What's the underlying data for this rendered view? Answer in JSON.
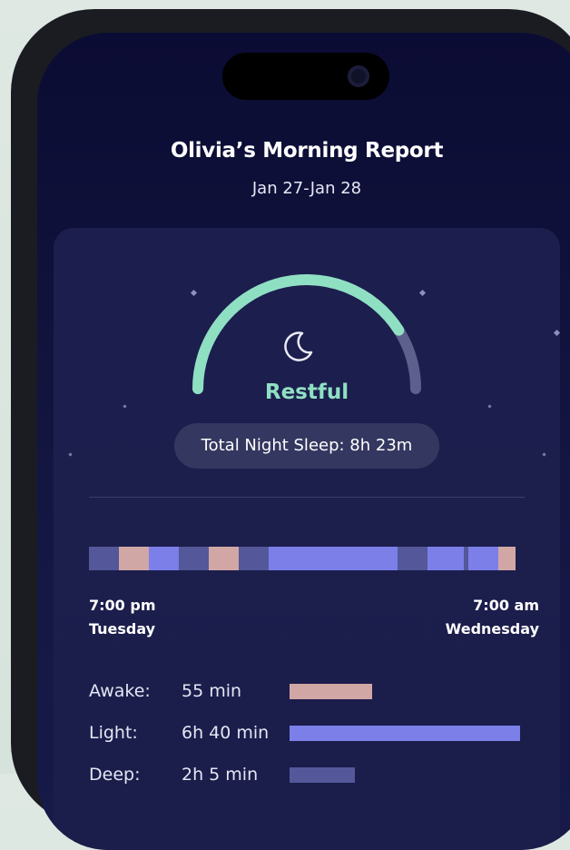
{
  "report": {
    "title": "Olivia’s Morning Report",
    "date_range": "Jan 27-Jan 28"
  },
  "score": {
    "label": "Restful",
    "gauge_fraction": 0.82,
    "icon": "moon-icon",
    "total_sleep_label": "Total Night Sleep: 8h 23m"
  },
  "colors": {
    "awake": "#d1a7a5",
    "light": "#7b7fe7",
    "deep": "#545799",
    "gauge_fill": "#8fe0c3",
    "gauge_track": "#5d5f8c"
  },
  "timeline": {
    "start_time": "7:00 pm",
    "start_day": "Tuesday",
    "end_time": "7:00 am",
    "end_day": "Wednesday",
    "segments": [
      {
        "stage": "deep",
        "fraction": 0.07
      },
      {
        "stage": "awake",
        "fraction": 0.07
      },
      {
        "stage": "light",
        "fraction": 0.07
      },
      {
        "stage": "deep",
        "fraction": 0.07
      },
      {
        "stage": "awake",
        "fraction": 0.07
      },
      {
        "stage": "deep",
        "fraction": 0.07
      },
      {
        "stage": "light",
        "fraction": 0.3
      },
      {
        "stage": "deep",
        "fraction": 0.07
      },
      {
        "stage": "light",
        "fraction": 0.085
      },
      {
        "stage": "deep",
        "fraction": 0.01
      },
      {
        "stage": "light",
        "fraction": 0.07
      },
      {
        "stage": "awake",
        "fraction": 0.04
      }
    ]
  },
  "stages": [
    {
      "name": "Awake:",
      "duration": "55 min",
      "stage": "awake",
      "fraction": 0.36
    },
    {
      "name": "Light:",
      "duration": "6h 40 min",
      "stage": "light",
      "fraction": 1.0
    },
    {
      "name": "Deep:",
      "duration": "2h 5 min",
      "stage": "deep",
      "fraction": 0.285
    }
  ]
}
